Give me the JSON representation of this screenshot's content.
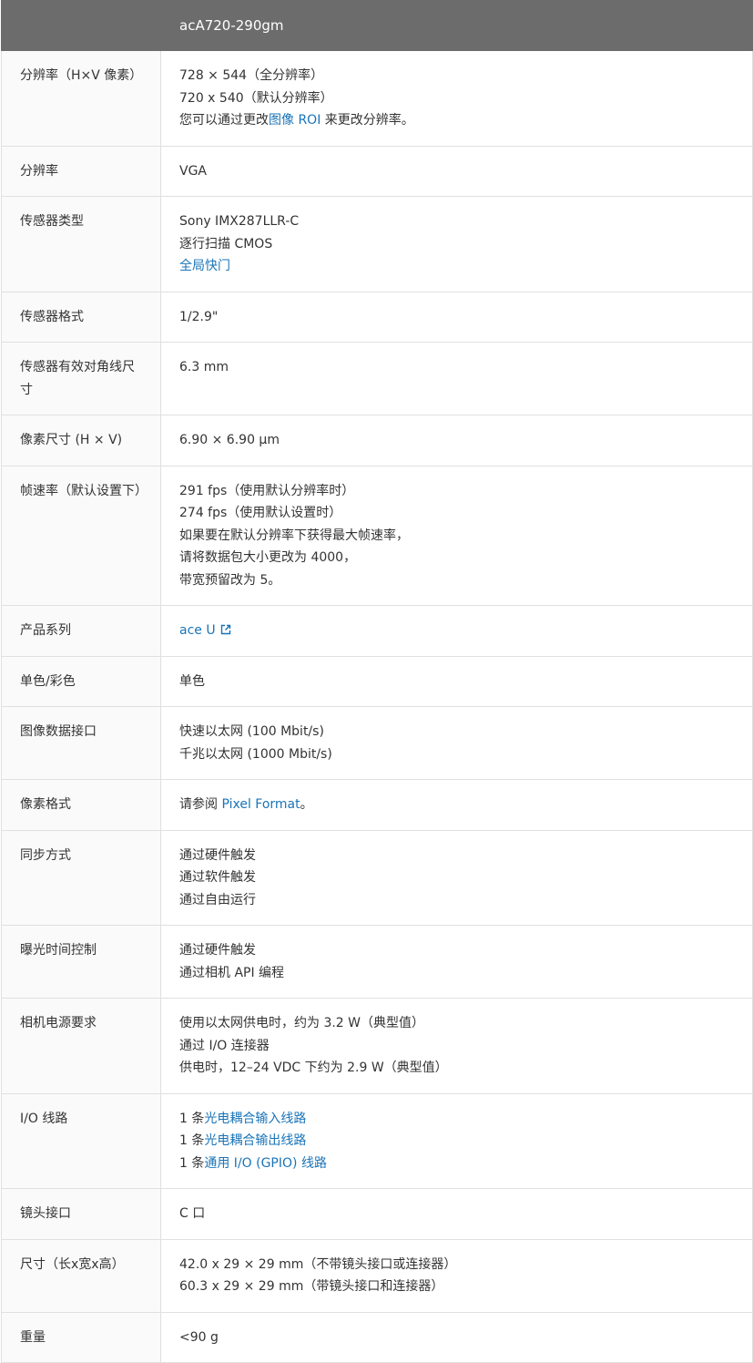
{
  "header": {
    "left": "",
    "model": "acA720-290gm"
  },
  "rows": [
    {
      "label": "分辨率（H×V 像素）",
      "lines": [
        [
          {
            "text": "728 × 544（全分辨率）"
          }
        ],
        [
          {
            "text": "720 x 540（默认分辨率）"
          }
        ],
        [
          {
            "text": "您可以通过更改"
          },
          {
            "text": "图像 ROI",
            "link": true
          },
          {
            "text": " 来更改分辨率。"
          }
        ]
      ]
    },
    {
      "label": "分辨率",
      "lines": [
        [
          {
            "text": "VGA"
          }
        ]
      ]
    },
    {
      "label": "传感器类型",
      "lines": [
        [
          {
            "text": "Sony IMX287LLR-C"
          }
        ],
        [
          {
            "text": "逐行扫描 CMOS"
          }
        ],
        [
          {
            "text": "全局快门",
            "link": true
          }
        ]
      ]
    },
    {
      "label": "传感器格式",
      "lines": [
        [
          {
            "text": "1/2.9\""
          }
        ]
      ]
    },
    {
      "label": "传感器有效对角线尺寸",
      "lines": [
        [
          {
            "text": "6.3 mm"
          }
        ]
      ]
    },
    {
      "label": "像素尺寸 (H × V)",
      "lines": [
        [
          {
            "text": "6.90 × 6.90 µm"
          }
        ]
      ]
    },
    {
      "label": "帧速率（默认设置下）",
      "lines": [
        [
          {
            "text": "291 fps（使用默认分辨率时）"
          }
        ],
        [
          {
            "text": "274 fps（使用默认设置时）"
          }
        ],
        [
          {
            "text": "如果要在默认分辨率下获得最大帧速率，"
          }
        ],
        [
          {
            "text": "请将数据包大小更改为 4000，"
          }
        ],
        [
          {
            "text": "带宽预留改为 5。"
          }
        ]
      ]
    },
    {
      "label": "产品系列",
      "lines": [
        [
          {
            "text": "ace U",
            "link": true,
            "icon": "external-link-icon"
          }
        ]
      ]
    },
    {
      "label": "单色/彩色",
      "lines": [
        [
          {
            "text": "单色"
          }
        ]
      ]
    },
    {
      "label": "图像数据接口",
      "lines": [
        [
          {
            "text": "快速以太网 (100 Mbit/s)"
          }
        ],
        [
          {
            "text": "千兆以太网 (1000 Mbit/s)"
          }
        ]
      ]
    },
    {
      "label": "像素格式",
      "lines": [
        [
          {
            "text": "请参阅 "
          },
          {
            "text": "Pixel Format",
            "link": true
          },
          {
            "text": "。"
          }
        ]
      ]
    },
    {
      "label": "同步方式",
      "lines": [
        [
          {
            "text": "通过硬件触发"
          }
        ],
        [
          {
            "text": "通过软件触发"
          }
        ],
        [
          {
            "text": "通过自由运行"
          }
        ]
      ]
    },
    {
      "label": "曝光时间控制",
      "lines": [
        [
          {
            "text": "通过硬件触发"
          }
        ],
        [
          {
            "text": "通过相机 API 编程"
          }
        ]
      ]
    },
    {
      "label": "相机电源要求",
      "lines": [
        [
          {
            "text": "使用以太网供电时，约为 3.2 W（典型值）"
          }
        ],
        [
          {
            "text": "通过 I/O 连接器"
          }
        ],
        [
          {
            "text": "供电时，12–24 VDC 下约为 2.9 W（典型值）"
          }
        ]
      ]
    },
    {
      "label": "I/O 线路",
      "lines": [
        [
          {
            "text": "1 条"
          },
          {
            "text": "光电耦合输入线路",
            "link": true
          }
        ],
        [
          {
            "text": "1 条"
          },
          {
            "text": "光电耦合输出线路",
            "link": true
          }
        ],
        [
          {
            "text": "1 条"
          },
          {
            "text": "通用 I/O (GPIO) 线路",
            "link": true
          }
        ]
      ]
    },
    {
      "label": "镜头接口",
      "lines": [
        [
          {
            "text": "C 口"
          }
        ]
      ]
    },
    {
      "label": "尺寸（长x宽x高）",
      "lines": [
        [
          {
            "text": "42.0 x 29 × 29 mm（不带镜头接口或连接器）"
          }
        ],
        [
          {
            "text": "60.3 x 29 × 29 mm（带镜头接口和连接器）"
          }
        ]
      ]
    },
    {
      "label": "重量",
      "lines": [
        [
          {
            "text": "<90 g"
          }
        ]
      ]
    }
  ],
  "colors": {
    "header_bg": "#6c6c6c",
    "header_text": "#ffffff",
    "label_bg": "#fafafa",
    "border": "#e0e0e0",
    "link": "#1a74b8",
    "text": "#333333"
  }
}
